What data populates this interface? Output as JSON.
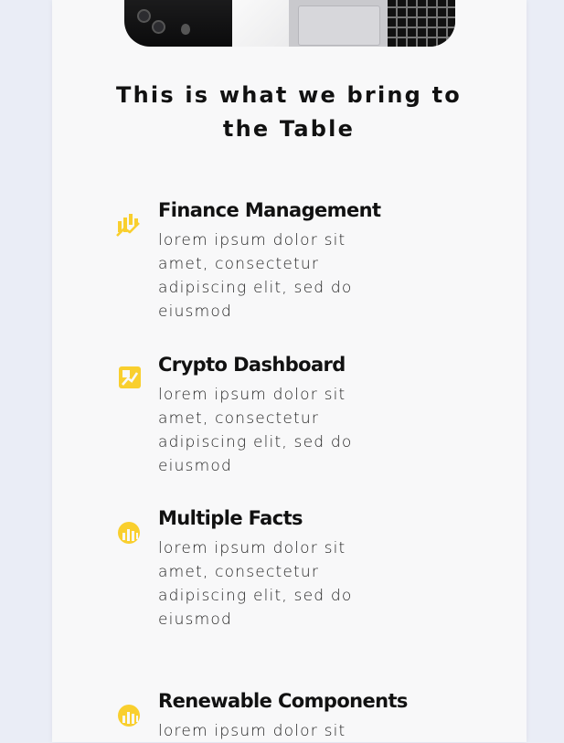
{
  "section": {
    "heading": "This is what we bring to the Table"
  },
  "features": [
    {
      "icon": "trending-chart-icon",
      "title": "Finance Management",
      "description": "lorem ipsum dolor sit amet, consectetur adipiscing elit, sed do eiusmod"
    },
    {
      "icon": "chart-square-icon",
      "title": "Crypto Dashboard",
      "description": "lorem ipsum dolor sit amet, consectetur adipiscing elit, sed do eiusmod"
    },
    {
      "icon": "bar-chart-circle-icon",
      "title": "Multiple Facts",
      "description": "lorem ipsum dolor sit amet, consectetur adipiscing elit, sed do eiusmod"
    },
    {
      "icon": "bar-chart-circle-icon",
      "title": "Renewable Components",
      "description": "lorem ipsum dolor sit"
    }
  ],
  "colors": {
    "accent": "#f9cf2e",
    "page_background": "#eaedf6",
    "card_background": "#f8f8f9",
    "text": "#111111"
  }
}
